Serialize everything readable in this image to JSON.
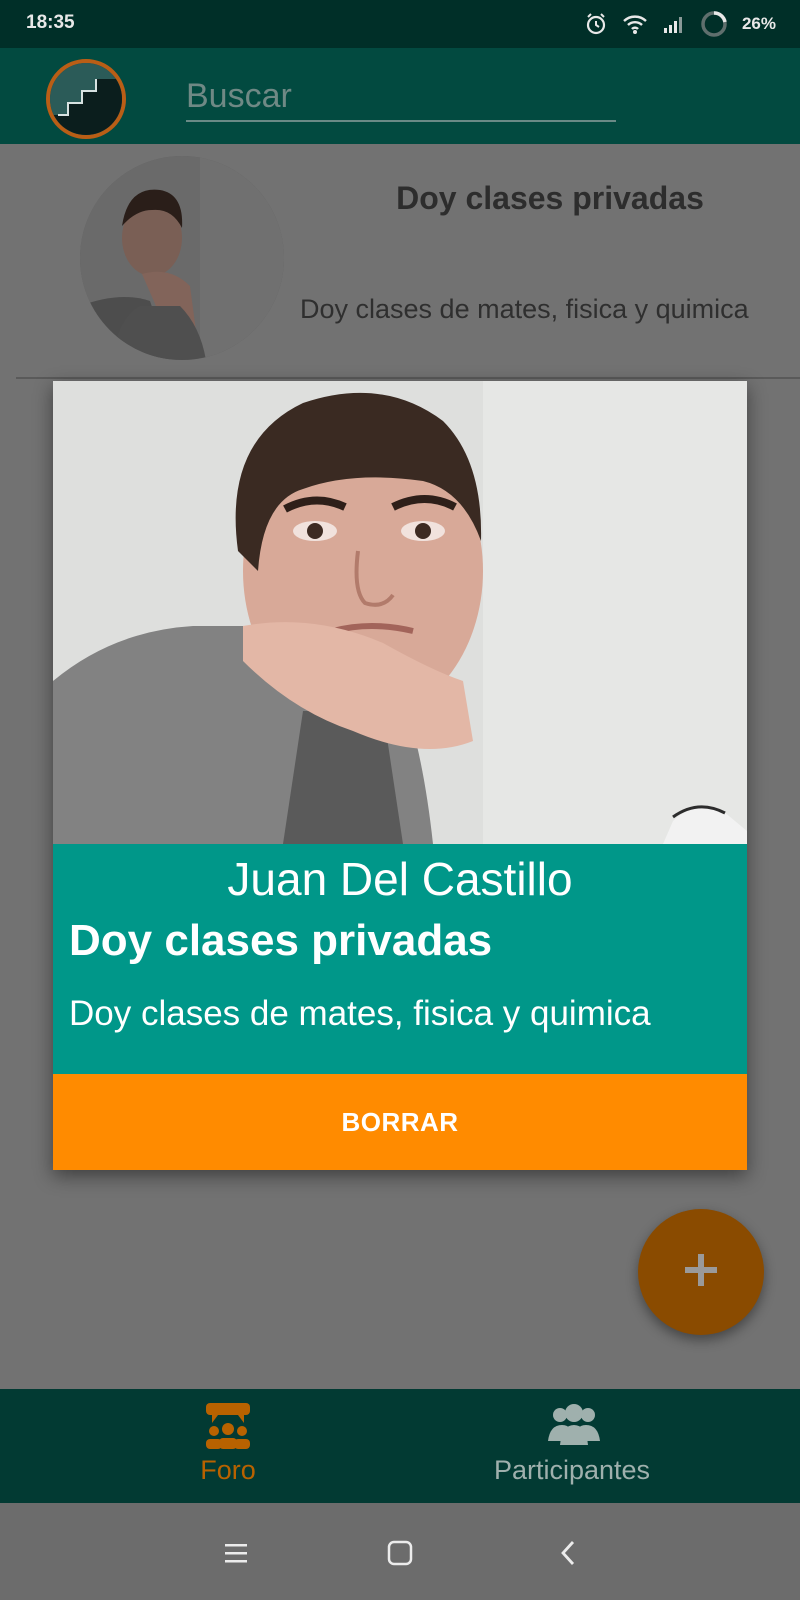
{
  "status_bar": {
    "time": "18:35",
    "battery": "26%",
    "icons": [
      "alarm-icon",
      "wifi-icon",
      "signal-icon",
      "battery-ring-icon"
    ]
  },
  "app_bar": {
    "search_placeholder": "Buscar"
  },
  "post": {
    "title": "Doy clases privadas",
    "description": "Doy clases de mates, fisica y quimica"
  },
  "dialog": {
    "name": "Juan Del Castillo",
    "title": "Doy clases privadas",
    "description": "Doy clases de mates, fisica y quimica",
    "delete_label": "BORRAR"
  },
  "fab": {
    "icon": "plus-icon"
  },
  "bottom_nav": {
    "items": [
      {
        "label": "Foro",
        "icon": "forum-icon",
        "active": true
      },
      {
        "label": "Participantes",
        "icon": "people-icon",
        "active": false
      }
    ]
  },
  "system_nav": {
    "icons": [
      "menu-icon",
      "home-icon",
      "back-icon"
    ]
  },
  "colors": {
    "primary_dark": "#002f28",
    "primary": "#009789",
    "accent": "#ff8b00",
    "nav_active": "#b86200",
    "nav_inactive": "#9fb0ad"
  }
}
